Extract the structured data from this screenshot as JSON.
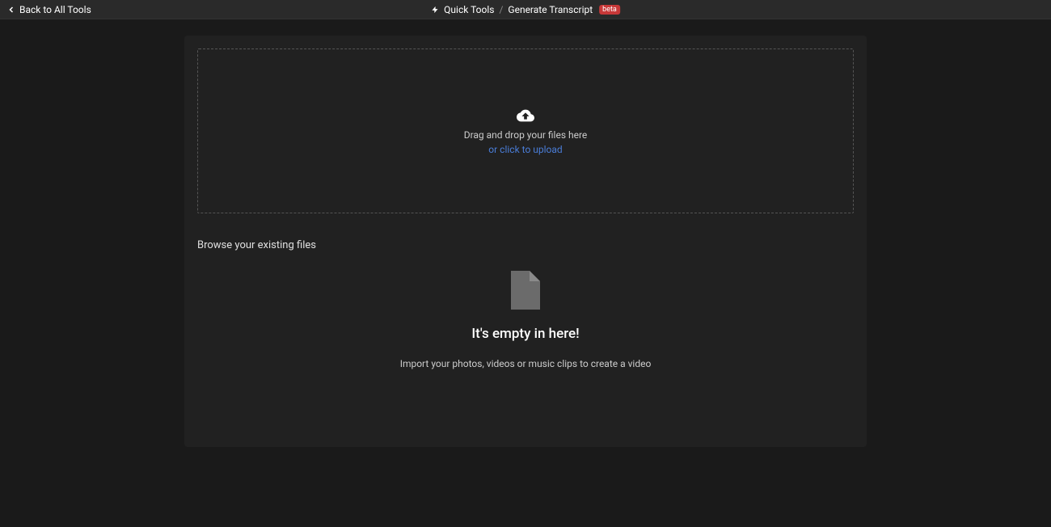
{
  "header": {
    "back_label": "Back to All Tools",
    "breadcrumb": {
      "root": "Quick Tools",
      "separator": "/",
      "current": "Generate Transcript",
      "badge": "beta"
    }
  },
  "dropzone": {
    "main_text": "Drag and drop your files here",
    "link_text": "or click to upload"
  },
  "browse": {
    "heading": "Browse your existing files"
  },
  "empty_state": {
    "title": "It's empty in here!",
    "subtitle": "Import your photos, videos or music clips to create a video"
  }
}
